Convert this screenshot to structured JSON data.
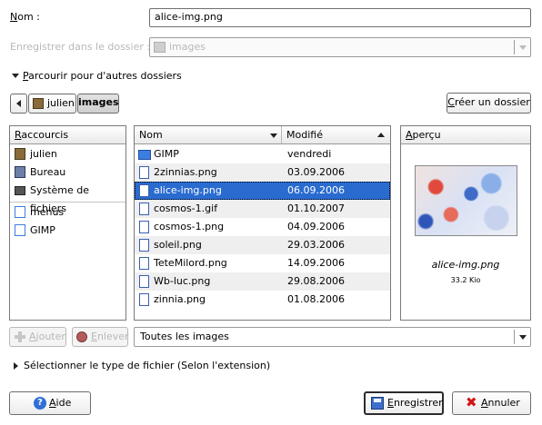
{
  "form": {
    "name_label": "Nom :",
    "name_value": "alice-img.png",
    "save_in_label": "Enregistrer dans le dossier :",
    "save_in_value": "images",
    "browse_label": "Parcourir pour d'autres dossiers"
  },
  "path_bar": {
    "segments": [
      "julien",
      "images"
    ],
    "create_folder": "Créer un dossier"
  },
  "shortcuts": {
    "header": "Raccourcis",
    "items": [
      {
        "label": "julien",
        "icon": "home-icon"
      },
      {
        "label": "Bureau",
        "icon": "desktop-icon"
      },
      {
        "label": "Système de fichiers",
        "icon": "harddisk-icon"
      },
      {
        "label": "menus",
        "icon": "folder-icon"
      },
      {
        "label": "GIMP",
        "icon": "folder-icon"
      }
    ],
    "add_button": "Ajouter",
    "remove_button": "Enlever"
  },
  "files": {
    "col_name": "Nom",
    "col_modified": "Modifié",
    "rows": [
      {
        "name": "GIMP",
        "modified": "vendredi",
        "icon": "folder-icon"
      },
      {
        "name": "2zinnias.png",
        "modified": "03.09.2006",
        "icon": "image-file-icon"
      },
      {
        "name": "alice-img.png",
        "modified": "06.09.2006",
        "icon": "image-file-icon"
      },
      {
        "name": "cosmos-1.gif",
        "modified": "01.10.2007",
        "icon": "image-file-icon"
      },
      {
        "name": "cosmos-1.png",
        "modified": "04.09.2006",
        "icon": "image-file-icon"
      },
      {
        "name": "soleil.png",
        "modified": "29.03.2006",
        "icon": "image-file-icon"
      },
      {
        "name": "TeteMilord.png",
        "modified": "14.09.2006",
        "icon": "image-file-icon"
      },
      {
        "name": "Wb-luc.png",
        "modified": "29.08.2006",
        "icon": "image-file-icon"
      },
      {
        "name": "zinnia.png",
        "modified": "01.08.2006",
        "icon": "image-file-icon"
      }
    ],
    "filter": "Toutes les images"
  },
  "preview": {
    "header": "Aperçu",
    "filename": "alice-img.png",
    "size": "33.2 Kio"
  },
  "filetype_expander": "Sélectionner le type de fichier (Selon l'extension)",
  "buttons": {
    "help": "Aide",
    "save": "Enregistrer",
    "cancel": "Annuler"
  },
  "colors": {
    "selection": "#2a6bd0",
    "folder": "#3d7de0",
    "cancel_icon": "#d01515",
    "help_icon": "#2f6fd6"
  }
}
